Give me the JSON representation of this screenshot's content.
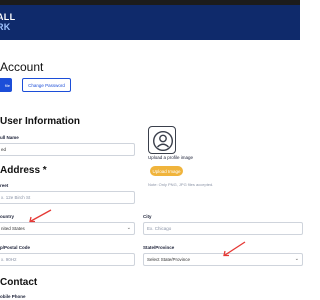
{
  "header": {
    "logo_line1": "ALL",
    "logo_line2": "RK",
    "background": "#0f2a6b"
  },
  "page": {
    "title": "Account"
  },
  "tabs": {
    "profile_label": "file",
    "change_password_label": "Change Password"
  },
  "user_info": {
    "heading": "User Information",
    "full_name": {
      "label": "ull Name",
      "value": "ed"
    }
  },
  "profile_image": {
    "label": "Upload a profile image",
    "button": "Upload Image",
    "note": "Note: Only PNG, JPG files accepted."
  },
  "address": {
    "heading": "Address *",
    "street": {
      "label": "reet",
      "placeholder": "x. 12e Birch St"
    },
    "country": {
      "label": "ountry",
      "value": "nited States"
    },
    "city": {
      "label": "City",
      "placeholder": "Ex. Chicago"
    },
    "postal": {
      "label": "p/Postal Code",
      "placeholder": "x. 90H2"
    },
    "state": {
      "label": "State/Province",
      "placeholder": "Select State/Province"
    }
  },
  "contact": {
    "heading": "Contact",
    "mobile": {
      "label": "obile Phone"
    }
  },
  "icons": {
    "chevron": "chevron-down-icon",
    "avatar": "user-icon",
    "arrow": "red-arrow"
  },
  "colors": {
    "primary": "#1c4ed8",
    "upload": "#f0b43c",
    "arrow": "#e53935"
  }
}
